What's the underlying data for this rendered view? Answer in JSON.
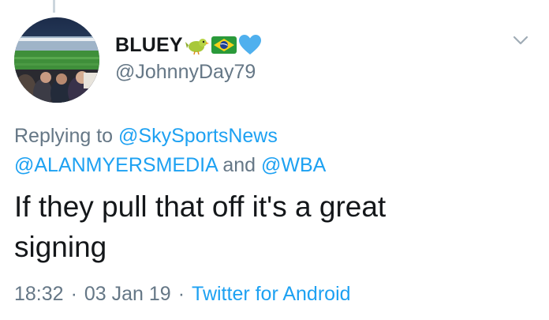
{
  "tweet": {
    "display_name": "BLUEY",
    "name_emojis": [
      "bird-emoji",
      "brazil-flag-emoji",
      "blue-heart-emoji"
    ],
    "handle": "@JohnnyDay79",
    "replying_prefix": "Replying to",
    "mentions": [
      "@SkySportsNews",
      "@ALANMYERSMEDIA",
      "@WBA"
    ],
    "replying_joiner": "and",
    "text_line1": "If they pull that off it's a great",
    "text_line2": "signing",
    "time": "18:32",
    "date": "03 Jan 19",
    "separator": "·",
    "source": "Twitter for Android"
  },
  "colors": {
    "text": "#14171a",
    "secondary": "#657786",
    "link": "#1da1f2",
    "thread_line": "#ccd6dd"
  },
  "icons": {
    "menu": "chevron-down-icon",
    "avatar": "stadium-photo"
  }
}
